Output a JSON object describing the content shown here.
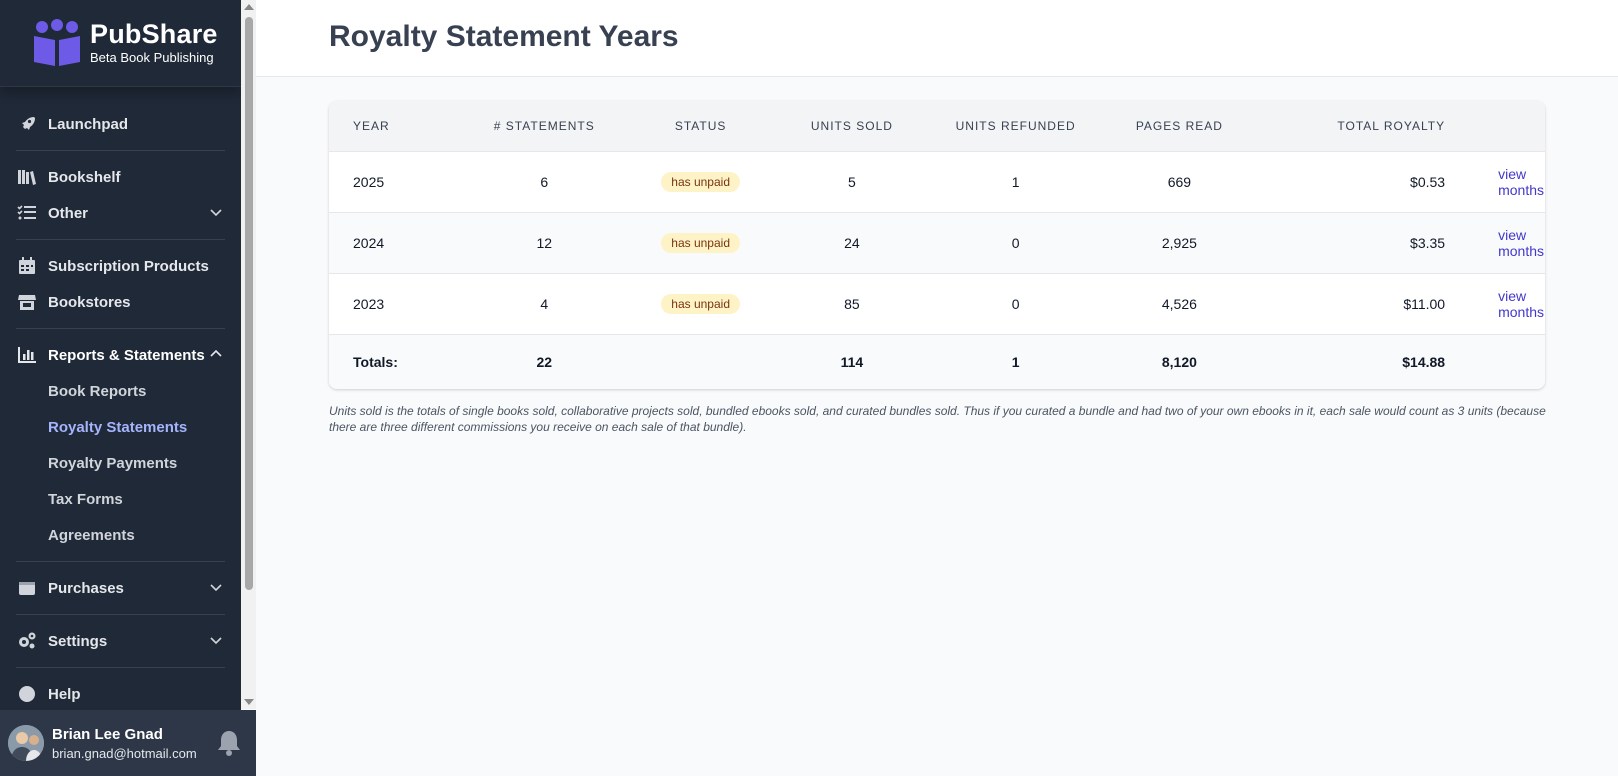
{
  "brand": {
    "name": "PubShare",
    "subtitle": "Beta Book Publishing",
    "accent": "#6d5ae6"
  },
  "sidebar": {
    "items": [
      {
        "label": "Launchpad",
        "icon": "rocket-icon"
      },
      {
        "label": "Bookshelf",
        "icon": "books-icon"
      },
      {
        "label": "Other",
        "icon": "list-check-icon"
      },
      {
        "label": "Subscription Products",
        "icon": "calendar-icon"
      },
      {
        "label": "Bookstores",
        "icon": "store-icon"
      },
      {
        "label": "Reports & Statements",
        "icon": "bar-chart-icon"
      },
      {
        "label": "Purchases",
        "icon": "wallet-icon"
      },
      {
        "label": "Settings",
        "icon": "gears-icon"
      },
      {
        "label": "Help",
        "icon": "help-icon"
      }
    ],
    "reports_sub": [
      {
        "label": "Book Reports"
      },
      {
        "label": "Royalty Statements"
      },
      {
        "label": "Royalty Payments"
      },
      {
        "label": "Tax Forms"
      },
      {
        "label": "Agreements"
      }
    ]
  },
  "user": {
    "name": "Brian Lee Gnad",
    "email": "brian.gnad@hotmail.com"
  },
  "page": {
    "title": "Royalty Statement Years"
  },
  "table": {
    "headers": [
      "Year",
      "# Statements",
      "Status",
      "Units Sold",
      "Units Refunded",
      "Pages Read",
      "Total Royalty"
    ],
    "rows": [
      {
        "year": "2025",
        "statements": "6",
        "status": "has unpaid",
        "units_sold": "5",
        "units_refunded": "1",
        "pages_read": "669",
        "total_royalty": "$0.53",
        "link": "view months"
      },
      {
        "year": "2024",
        "statements": "12",
        "status": "has unpaid",
        "units_sold": "24",
        "units_refunded": "0",
        "pages_read": "2,925",
        "total_royalty": "$3.35",
        "link": "view months"
      },
      {
        "year": "2023",
        "statements": "4",
        "status": "has unpaid",
        "units_sold": "85",
        "units_refunded": "0",
        "pages_read": "4,526",
        "total_royalty": "$11.00",
        "link": "view months"
      }
    ],
    "totals": {
      "label": "Totals:",
      "statements": "22",
      "units_sold": "114",
      "units_refunded": "1",
      "pages_read": "8,120",
      "total_royalty": "$14.88"
    }
  },
  "note": "Units sold is the totals of single books sold, collaborative projects sold, bundled ebooks sold, and curated bundles sold. Thus if you curated a bundle and had two of your own ebooks in it, each sale would count as 3 units (because there are three different commissions you receive on each sale of that bundle)."
}
